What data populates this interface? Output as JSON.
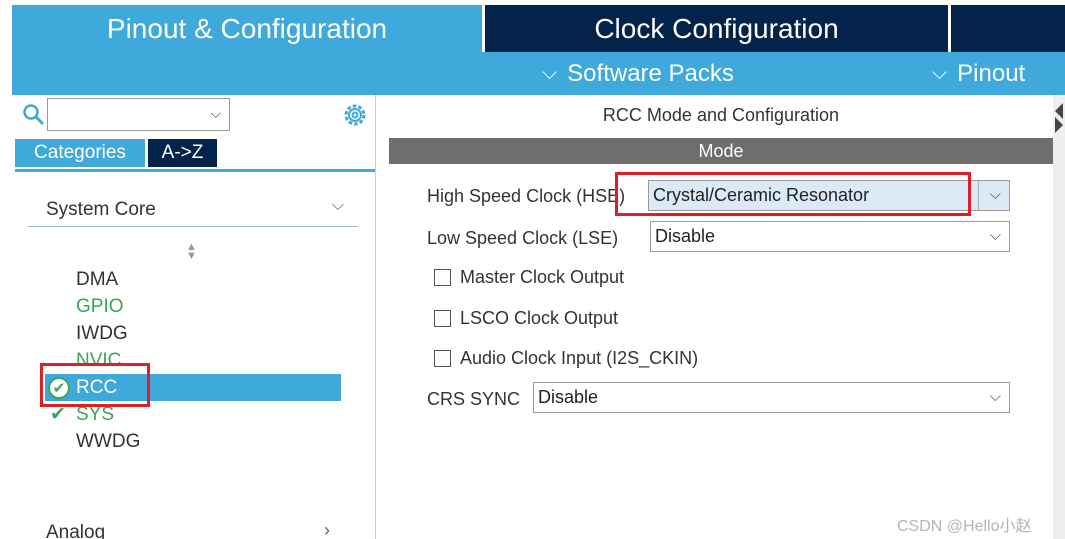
{
  "top_tabs": {
    "pinout": "Pinout & Configuration",
    "clock": "Clock Configuration"
  },
  "sub_bar": {
    "software_packs": "Software Packs",
    "pinout": "Pinout"
  },
  "left_panel": {
    "search": {
      "value": ""
    },
    "tabs": {
      "categories": "Categories",
      "az": "A->Z"
    },
    "section": "System Core",
    "items": [
      {
        "label": "DMA",
        "state": "normal"
      },
      {
        "label": "GPIO",
        "state": "green"
      },
      {
        "label": "IWDG",
        "state": "normal"
      },
      {
        "label": "NVIC",
        "state": "green"
      },
      {
        "label": "RCC",
        "state": "selected-checked"
      },
      {
        "label": "SYS",
        "state": "green-checked"
      },
      {
        "label": "WWDG",
        "state": "normal"
      }
    ],
    "next_section": "Analog"
  },
  "right_panel": {
    "title": "RCC Mode and Configuration",
    "mode_header": "Mode",
    "hse": {
      "label": "High Speed Clock (HSE)",
      "value": "Crystal/Ceramic Resonator"
    },
    "lse": {
      "label": "Low Speed Clock (LSE)",
      "value": "Disable"
    },
    "checkboxes": [
      {
        "label": "Master Clock Output",
        "checked": false
      },
      {
        "label": "LSCO Clock Output",
        "checked": false
      },
      {
        "label": "Audio Clock Input (I2S_CKIN)",
        "checked": false
      }
    ],
    "crs_sync": {
      "label": "CRS SYNC",
      "value": "Disable"
    }
  },
  "watermark": "CSDN @Hello小赵",
  "colors": {
    "accent_blue": "#3fa9dc",
    "navy": "#03234b",
    "green": "#3aa654",
    "highlight_red": "#e01e26",
    "mode_bar": "#6e6e6e"
  }
}
